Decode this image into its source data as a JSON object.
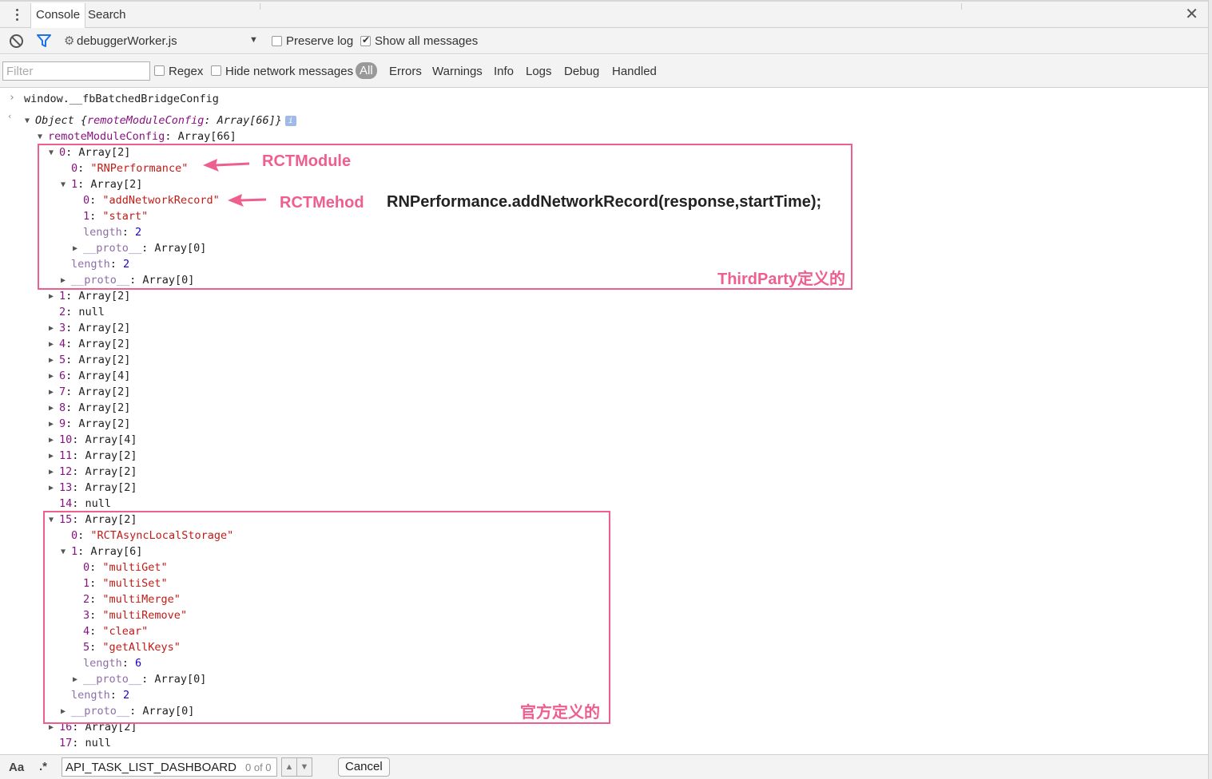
{
  "tabs": {
    "console": "Console",
    "search": "Search"
  },
  "toolbar": {
    "context": "debuggerWorker.js",
    "preserve_log": "Preserve log",
    "preserve_log_checked": false,
    "show_all": "Show all messages",
    "show_all_checked": true
  },
  "filterbar": {
    "filter_placeholder": "Filter",
    "regex": "Regex",
    "hide_network": "Hide network messages",
    "levels": {
      "all": "All",
      "errors": "Errors",
      "warnings": "Warnings",
      "info": "Info",
      "logs": "Logs",
      "debug": "Debug",
      "handled": "Handled"
    }
  },
  "console": {
    "input": "window.__fbBatchedBridgeConfig",
    "result_prefix": "Object {",
    "result_key": "remoteModuleConfig",
    "result_val": ": Array[66]}",
    "lines": {
      "root": {
        "k": "remoteModuleConfig",
        "v": ": Array[66]"
      },
      "i0": {
        "k": "0",
        "v": ": Array[2]"
      },
      "i0_0": {
        "k": "0",
        "v": "\"RNPerformance\""
      },
      "i0_1": {
        "k": "1",
        "v": ": Array[2]"
      },
      "i0_1_0": {
        "k": "0",
        "v": "\"addNetworkRecord\""
      },
      "i0_1_1": {
        "k": "1",
        "v": "\"start\""
      },
      "i0_1_len": {
        "k": "length",
        "v": "2"
      },
      "i0_1_proto": {
        "k": "__proto__",
        "v": ": Array[0]"
      },
      "i0_len": {
        "k": "length",
        "v": "2"
      },
      "i0_proto": {
        "k": "__proto__",
        "v": ": Array[0]"
      },
      "i1": {
        "k": "1",
        "v": ": Array[2]"
      },
      "i2": {
        "k": "2",
        "v": ": null"
      },
      "i3": {
        "k": "3",
        "v": ": Array[2]"
      },
      "i4": {
        "k": "4",
        "v": ": Array[2]"
      },
      "i5": {
        "k": "5",
        "v": ": Array[2]"
      },
      "i6": {
        "k": "6",
        "v": ": Array[4]"
      },
      "i7": {
        "k": "7",
        "v": ": Array[2]"
      },
      "i8": {
        "k": "8",
        "v": ": Array[2]"
      },
      "i9": {
        "k": "9",
        "v": ": Array[2]"
      },
      "i10": {
        "k": "10",
        "v": ": Array[4]"
      },
      "i11": {
        "k": "11",
        "v": ": Array[2]"
      },
      "i12": {
        "k": "12",
        "v": ": Array[2]"
      },
      "i13": {
        "k": "13",
        "v": ": Array[2]"
      },
      "i14": {
        "k": "14",
        "v": ": null"
      },
      "i15": {
        "k": "15",
        "v": ": Array[2]"
      },
      "i15_0": {
        "k": "0",
        "v": "\"RCTAsyncLocalStorage\""
      },
      "i15_1": {
        "k": "1",
        "v": ": Array[6]"
      },
      "i15_1_0": {
        "k": "0",
        "v": "\"multiGet\""
      },
      "i15_1_1": {
        "k": "1",
        "v": "\"multiSet\""
      },
      "i15_1_2": {
        "k": "2",
        "v": "\"multiMerge\""
      },
      "i15_1_3": {
        "k": "3",
        "v": "\"multiRemove\""
      },
      "i15_1_4": {
        "k": "4",
        "v": "\"clear\""
      },
      "i15_1_5": {
        "k": "5",
        "v": "\"getAllKeys\""
      },
      "i15_1_len": {
        "k": "length",
        "v": "6"
      },
      "i15_1_proto": {
        "k": "__proto__",
        "v": ": Array[0]"
      },
      "i15_len": {
        "k": "length",
        "v": "2"
      },
      "i15_proto": {
        "k": "__proto__",
        "v": ": Array[0]"
      },
      "i16": {
        "k": "16",
        "v": ": Array[2]"
      },
      "i17": {
        "k": "17",
        "v": ": null"
      }
    }
  },
  "annotations": {
    "module": "RCTModule",
    "method": "RCTMehod",
    "call_example": "RNPerformance.addNetworkRecord(response,startTime);",
    "thirdparty": "ThirdParty定义的",
    "official": "官方定义的",
    "color": "#ee5f8e"
  },
  "searchbar": {
    "case_toggle": "Aa",
    "regex_toggle": ".*",
    "query": "API_TASK_LIST_DASHBOARD",
    "match_count": "0 of 0",
    "cancel": "Cancel"
  }
}
